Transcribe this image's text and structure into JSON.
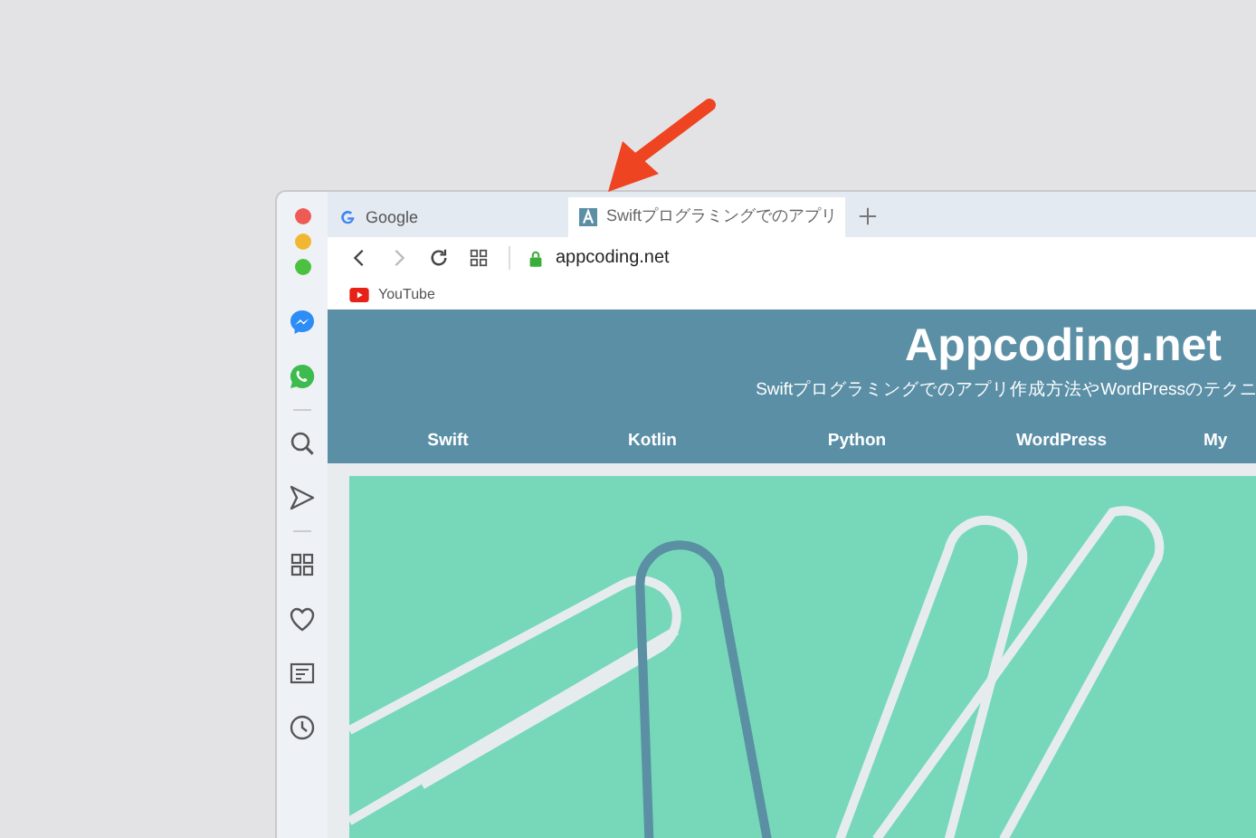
{
  "tabs": [
    {
      "title": "Google",
      "selected": false
    },
    {
      "title": "Swiftプログラミングでのアプリ",
      "selected": true
    }
  ],
  "address_bar": {
    "url": "appcoding.net"
  },
  "bookmarks": [
    {
      "label": "YouTube"
    }
  ],
  "site": {
    "title": "Appcoding.net",
    "subtitle": "Swiftプログラミングでのアプリ作成方法やWordPressのテクニ",
    "nav": [
      "Swift",
      "Kotlin",
      "Python",
      "WordPress",
      "My"
    ]
  }
}
